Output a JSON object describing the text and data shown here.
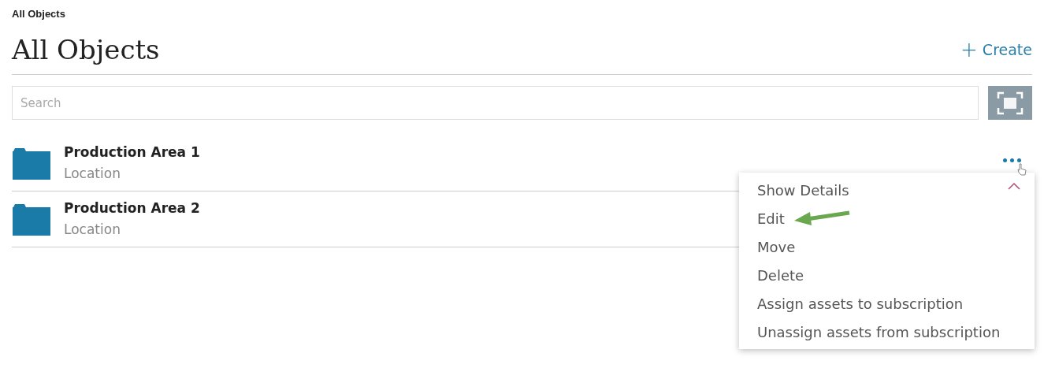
{
  "breadcrumb": "All Objects",
  "title": "All Objects",
  "create_button": {
    "icon": "+",
    "label": "Create"
  },
  "search": {
    "placeholder": "Search"
  },
  "items": [
    {
      "name": "Production Area 1",
      "type": "Location",
      "menu_open": true
    },
    {
      "name": "Production Area 2",
      "type": "Location",
      "menu_open": false
    }
  ],
  "menu": {
    "items": [
      {
        "label": "Show Details",
        "highlighted": false
      },
      {
        "label": "Edit",
        "highlighted": true
      },
      {
        "label": "Move",
        "highlighted": false
      },
      {
        "label": "Delete",
        "highlighted": false
      },
      {
        "label": "Assign assets to subscription",
        "highlighted": false
      },
      {
        "label": "Unassign assets from subscription",
        "highlighted": false
      }
    ]
  }
}
